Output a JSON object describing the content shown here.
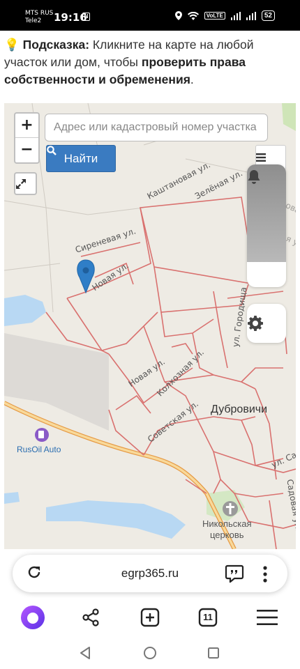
{
  "status_bar": {
    "carrier_1": "MTS RUS",
    "carrier_2": "Tele2",
    "time": "19:16",
    "nfc": "N",
    "volte": "VoLTE",
    "battery": "52"
  },
  "hint": {
    "emoji": "💡",
    "label": "Подсказка:",
    "text_1": " Кликните на карте на любой участок или дом, чтобы ",
    "bold_text": "проверить права собственности и обременения",
    "text_2": "."
  },
  "map": {
    "zoom_in": "+",
    "zoom_out": "−",
    "search_placeholder": "Адрес или кадастровый номер участка",
    "find_button": "Найти",
    "place_name": "Дубровичи",
    "poi_name": "RusOil Auto",
    "church_line_1": "Никольская",
    "church_line_2": "церковь",
    "streets": {
      "sirenevaya": "Сиреневая ул.",
      "novaya_1": "Новая ул.",
      "kashtanovaya": "Каштановая ул.",
      "zelenaya": "Зелёная ул.",
      "novaya_2": "Новая ул.",
      "kolkhoznaya": "Колхозная ул.",
      "sovetskaya": "Советская ул.",
      "gorodischa": "ул. Городища",
      "rodnikovaya": "Родниковая ул.",
      "zelenaya_2": "Зелёная ул.",
      "ul_sa": "ул. Са",
      "sadovaya": "Садовая ул."
    },
    "colors": {
      "parcel_border": "#d9716f",
      "road": "#f0b35a",
      "water": "#b8d8f3",
      "pin": "#2f7ec7"
    }
  },
  "browser": {
    "url": "egrp365.ru",
    "tabs_count": "11"
  }
}
